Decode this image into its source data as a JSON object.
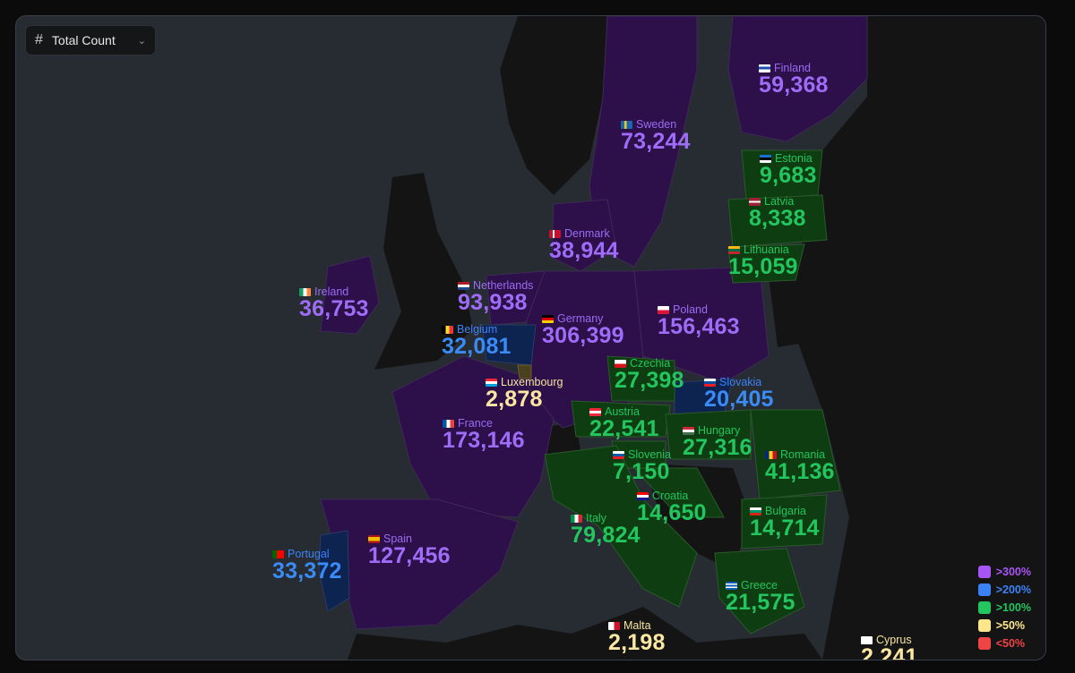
{
  "control": {
    "label": "Total Count",
    "icon": "hash-icon"
  },
  "legend": [
    {
      "label": ">300%",
      "color": "#a855f7"
    },
    {
      "label": ">200%",
      "color": "#3b82f6"
    },
    {
      "label": ">100%",
      "color": "#22c55e"
    },
    {
      "label": ">50%",
      "color": "#fde68a"
    },
    {
      "label": "<50%",
      "color": "#ef4444"
    }
  ],
  "countries": {
    "finland": {
      "name": "Finland",
      "value": "59,368",
      "tier": ">300%"
    },
    "sweden": {
      "name": "Sweden",
      "value": "73,244",
      "tier": ">300%"
    },
    "estonia": {
      "name": "Estonia",
      "value": "9,683",
      "tier": ">100%"
    },
    "latvia": {
      "name": "Latvia",
      "value": "8,338",
      "tier": ">100%"
    },
    "denmark": {
      "name": "Denmark",
      "value": "38,944",
      "tier": ">300%"
    },
    "lithuania": {
      "name": "Lithuania",
      "value": "15,059",
      "tier": ">100%"
    },
    "netherlands": {
      "name": "Netherlands",
      "value": "93,938",
      "tier": ">300%"
    },
    "ireland": {
      "name": "Ireland",
      "value": "36,753",
      "tier": ">300%"
    },
    "poland": {
      "name": "Poland",
      "value": "156,463",
      "tier": ">300%"
    },
    "germany": {
      "name": "Germany",
      "value": "306,399",
      "tier": ">300%"
    },
    "belgium": {
      "name": "Belgium",
      "value": "32,081",
      "tier": ">200%"
    },
    "czechia": {
      "name": "Czechia",
      "value": "27,398",
      "tier": ">100%"
    },
    "luxembourg": {
      "name": "Luxembourg",
      "value": "2,878",
      "tier": ">50%"
    },
    "slovakia": {
      "name": "Slovakia",
      "value": "20,405",
      "tier": ">200%"
    },
    "austria": {
      "name": "Austria",
      "value": "22,541",
      "tier": ">100%"
    },
    "france": {
      "name": "France",
      "value": "173,146",
      "tier": ">300%"
    },
    "hungary": {
      "name": "Hungary",
      "value": "27,316",
      "tier": ">100%"
    },
    "slovenia": {
      "name": "Slovenia",
      "value": "7,150",
      "tier": ">100%"
    },
    "romania": {
      "name": "Romania",
      "value": "41,136",
      "tier": ">100%"
    },
    "croatia": {
      "name": "Croatia",
      "value": "14,650",
      "tier": ">100%"
    },
    "italy": {
      "name": "Italy",
      "value": "79,824",
      "tier": ">100%"
    },
    "bulgaria": {
      "name": "Bulgaria",
      "value": "14,714",
      "tier": ">100%"
    },
    "portugal": {
      "name": "Portugal",
      "value": "33,372",
      "tier": ">200%"
    },
    "spain": {
      "name": "Spain",
      "value": "127,456",
      "tier": ">300%"
    },
    "greece": {
      "name": "Greece",
      "value": "21,575",
      "tier": ">100%"
    },
    "malta": {
      "name": "Malta",
      "value": "2,198",
      "tier": ">50%"
    },
    "cyprus": {
      "name": "Cyprus",
      "value": "2,241",
      "tier": ">50%"
    }
  }
}
